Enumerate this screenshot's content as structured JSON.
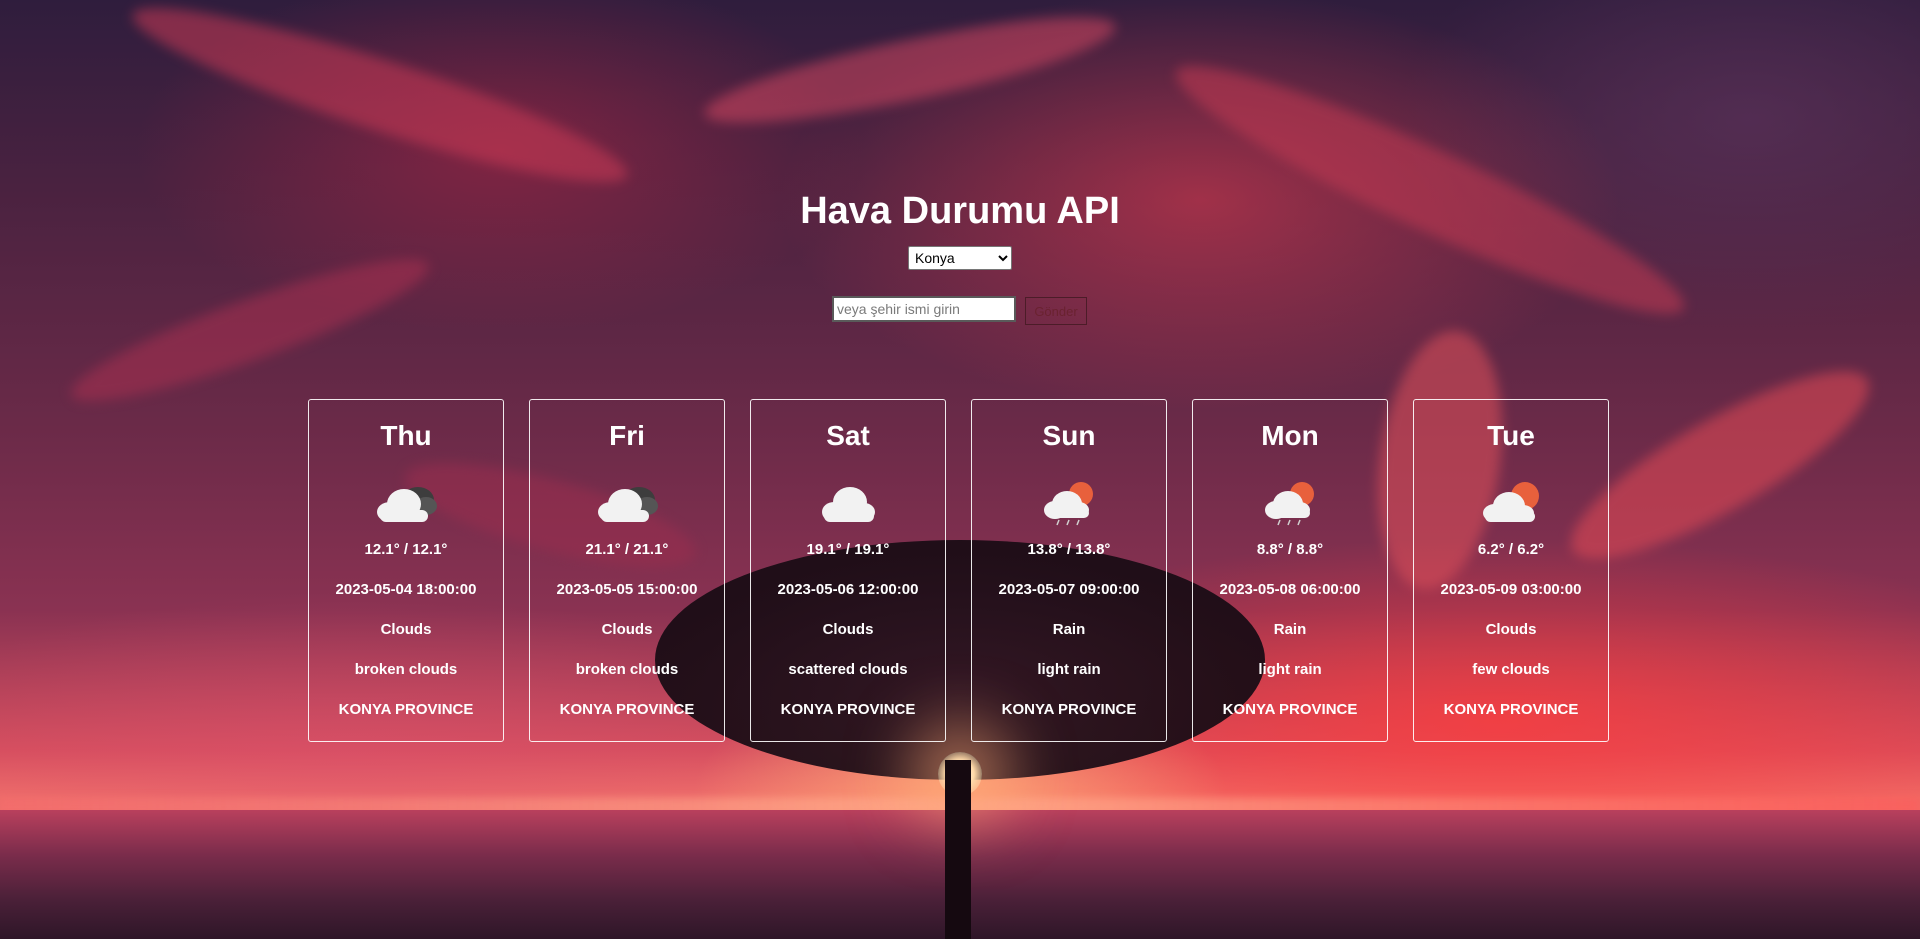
{
  "page": {
    "title": "Hava Durumu API"
  },
  "controls": {
    "selected_city": "Konya",
    "search_placeholder": "veya şehir ismi girin",
    "submit_label": "Gönder"
  },
  "forecast": [
    {
      "day": "Thu",
      "icon": "clouds-broken-icon",
      "temp": "12.1° / 12.1°",
      "datetime": "2023-05-04 18:00:00",
      "main": "Clouds",
      "description": "broken clouds",
      "location": "KONYA PROVINCE"
    },
    {
      "day": "Fri",
      "icon": "clouds-broken-icon",
      "temp": "21.1° / 21.1°",
      "datetime": "2023-05-05 15:00:00",
      "main": "Clouds",
      "description": "broken clouds",
      "location": "KONYA PROVINCE"
    },
    {
      "day": "Sat",
      "icon": "clouds-scattered-icon",
      "temp": "19.1° / 19.1°",
      "datetime": "2023-05-06 12:00:00",
      "main": "Clouds",
      "description": "scattered clouds",
      "location": "KONYA PROVINCE"
    },
    {
      "day": "Sun",
      "icon": "light-rain-icon",
      "temp": "13.8° / 13.8°",
      "datetime": "2023-05-07 09:00:00",
      "main": "Rain",
      "description": "light rain",
      "location": "KONYA PROVINCE"
    },
    {
      "day": "Mon",
      "icon": "light-rain-icon",
      "temp": "8.8° / 8.8°",
      "datetime": "2023-05-08 06:00:00",
      "main": "Rain",
      "description": "light rain",
      "location": "KONYA PROVINCE"
    },
    {
      "day": "Tue",
      "icon": "few-clouds-icon",
      "temp": "6.2° / 6.2°",
      "datetime": "2023-05-09 03:00:00",
      "main": "Clouds",
      "description": "few clouds",
      "location": "KONYA PROVINCE"
    }
  ],
  "colors": {
    "text": "#ffffff",
    "card_border": "#ffffff",
    "sun_orange": "#e8603c",
    "dark_cloud": "#4a4a4a",
    "white_cloud": "#f2f2f2"
  }
}
